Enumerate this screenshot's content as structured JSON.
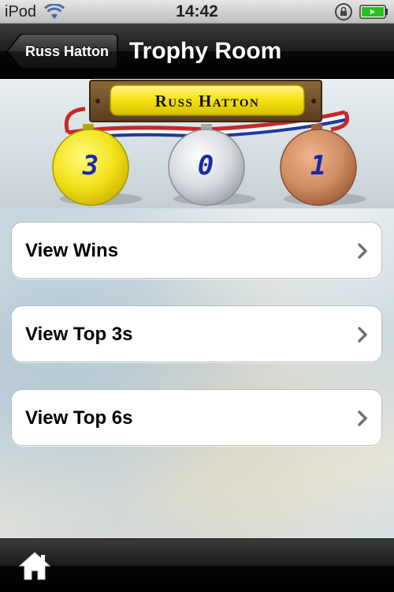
{
  "status_bar": {
    "carrier": "iPod",
    "time": "14:42",
    "icons": [
      "wifi-icon",
      "rotation-lock-icon",
      "battery-icon"
    ]
  },
  "nav_bar": {
    "back_label": "Russ Hatton",
    "title": "Trophy Room"
  },
  "trophy_header": {
    "player_name": "Russ Hatton",
    "medals": [
      {
        "type": "gold",
        "count": "3"
      },
      {
        "type": "silver",
        "count": "0"
      },
      {
        "type": "bronze",
        "count": "1"
      }
    ]
  },
  "menu": {
    "items": [
      {
        "label": "View Wins",
        "icon": "chevron-right-icon"
      },
      {
        "label": "View Top 3s",
        "icon": "chevron-right-icon"
      },
      {
        "label": "View Top 6s",
        "icon": "chevron-right-icon"
      }
    ]
  },
  "tab_bar": {
    "items": [
      {
        "icon": "home-icon"
      }
    ]
  },
  "colors": {
    "gold": "#f2e21a",
    "silver": "#c8ccd2",
    "bronze": "#cf8d63",
    "medal_digit": "#1a2aa8",
    "plaque_frame": "#6e4e2a",
    "plaque_face": "#f5e20f"
  }
}
